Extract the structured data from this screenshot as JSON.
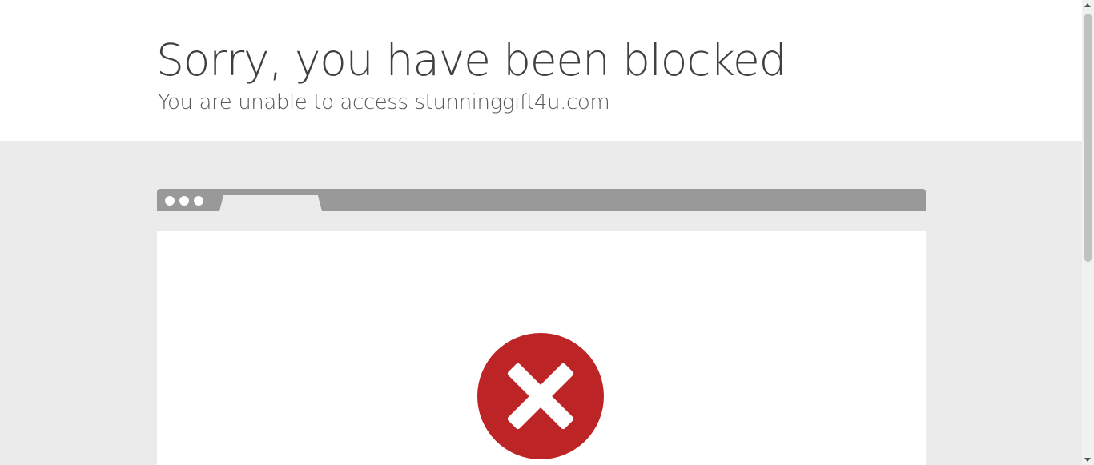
{
  "header": {
    "title": "Sorry, you have been blocked",
    "subtitle": "You are unable to access stunninggift4u.com"
  },
  "browser_illustration": {
    "error_icon": "x-circle-icon",
    "error_color": "#bd2426",
    "topbar_color": "#999999"
  },
  "colors": {
    "header_background": "#ffffff",
    "page_background": "#ebebeb",
    "title_text": "#404040",
    "subtitle_text": "#595959"
  }
}
